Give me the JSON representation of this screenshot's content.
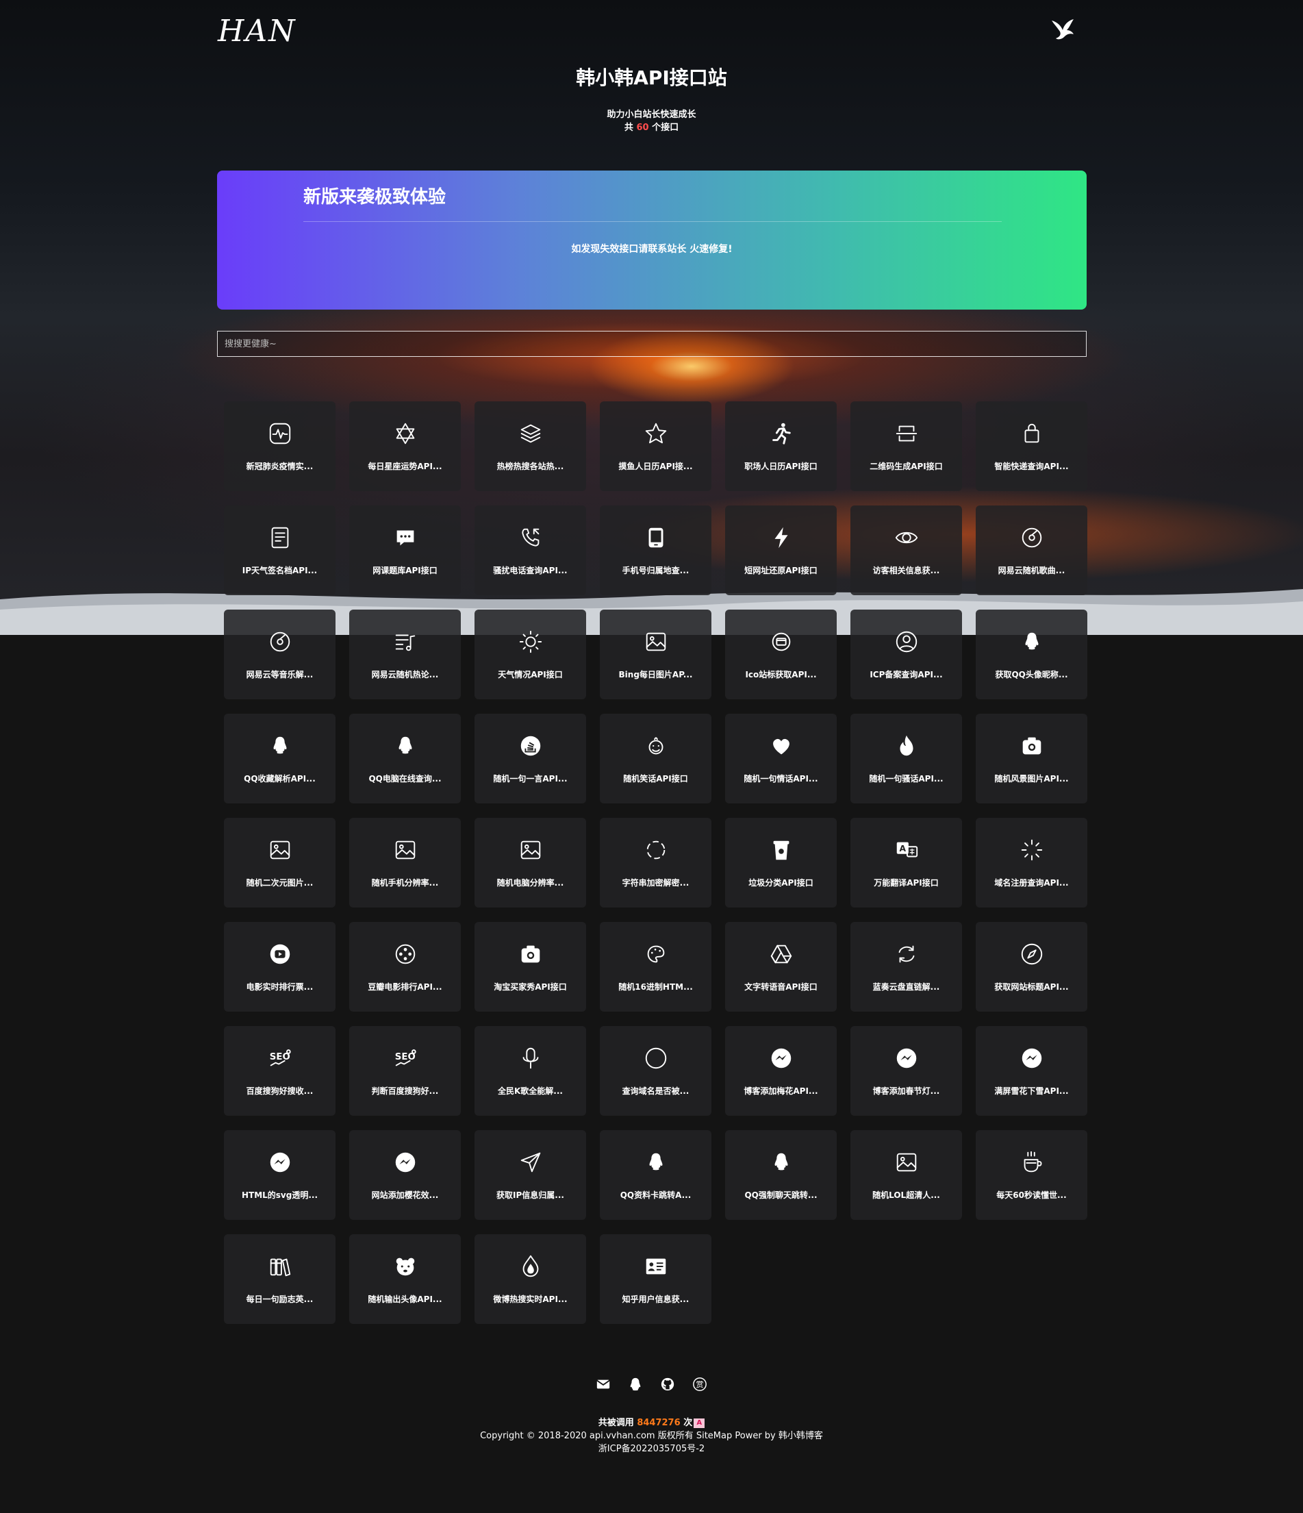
{
  "header": {
    "logo_text": "HAN",
    "site_title": "韩小韩API接口站",
    "subtitle": "助力小白站长快速成长",
    "count_prefix": "共",
    "count_value": "60",
    "count_suffix": "个接口"
  },
  "banner": {
    "title": "新版来袭极致体验",
    "text": "如发现失效接口请联系站长 火速修复!"
  },
  "search": {
    "placeholder": "搜搜更健康~"
  },
  "cards": [
    {
      "label": "新冠肺炎疫情实...",
      "icon": "pulse-icon"
    },
    {
      "label": "每日星座运势API...",
      "icon": "star-of-david-icon"
    },
    {
      "label": "热榜热搜各站热...",
      "icon": "layers-icon"
    },
    {
      "label": "摸鱼人日历API接...",
      "icon": "star-icon"
    },
    {
      "label": "职场人日历API接口",
      "icon": "running-person-icon"
    },
    {
      "label": "二维码生成API接口",
      "icon": "qrcode-icon"
    },
    {
      "label": "智能快递查询API...",
      "icon": "shopping-bag-icon"
    },
    {
      "label": "IP天气签名档API...",
      "icon": "document-icon"
    },
    {
      "label": "网课题库API接口",
      "icon": "chat-bubble-icon"
    },
    {
      "label": "骚扰电话查询API...",
      "icon": "phone-icon"
    },
    {
      "label": "手机号归属地查...",
      "icon": "tablet-icon"
    },
    {
      "label": "短网址还原API接口",
      "icon": "lightning-icon"
    },
    {
      "label": "访客相关信息获...",
      "icon": "eye-icon"
    },
    {
      "label": "网易云随机歌曲...",
      "icon": "disc-icon"
    },
    {
      "label": "网易云等音乐解...",
      "icon": "disc-icon"
    },
    {
      "label": "网易云随机热论...",
      "icon": "music-list-icon"
    },
    {
      "label": "天气情况API接口",
      "icon": "sun-icon"
    },
    {
      "label": "Bing每日图片AP...",
      "icon": "image-icon"
    },
    {
      "label": "Ico站标获取API...",
      "icon": "browser-icon"
    },
    {
      "label": "ICP备案查询API...",
      "icon": "user-circle-icon"
    },
    {
      "label": "获取QQ头像昵称...",
      "icon": "qq-icon"
    },
    {
      "label": "QQ收藏解析API...",
      "icon": "qq-icon"
    },
    {
      "label": "QQ电脑在线查询...",
      "icon": "qq-icon"
    },
    {
      "label": "随机一句一言API...",
      "icon": "stack-overflow-icon"
    },
    {
      "label": "随机笑话API接口",
      "icon": "laugh-icon"
    },
    {
      "label": "随机一句情话API...",
      "icon": "heart-icon"
    },
    {
      "label": "随机一句骚话API...",
      "icon": "fire-icon"
    },
    {
      "label": "随机风景图片API...",
      "icon": "camera-icon"
    },
    {
      "label": "随机二次元图片...",
      "icon": "image-icon"
    },
    {
      "label": "随机手机分辨率...",
      "icon": "image-icon"
    },
    {
      "label": "随机电脑分辨率...",
      "icon": "image-icon"
    },
    {
      "label": "字符串加密解密...",
      "icon": "loading-circle-icon"
    },
    {
      "label": "垃圾分类API接口",
      "icon": "trash-cup-icon"
    },
    {
      "label": "万能翻译API接口",
      "icon": "translate-icon"
    },
    {
      "label": "域名注册查询API...",
      "icon": "spinner-icon"
    },
    {
      "label": "电影实时排行票...",
      "icon": "play-icon"
    },
    {
      "label": "豆瓣电影排行API...",
      "icon": "film-reel-icon"
    },
    {
      "label": "淘宝买家秀API接口",
      "icon": "camera-icon"
    },
    {
      "label": "随机16进制HTM...",
      "icon": "palette-icon"
    },
    {
      "label": "文字转语音API接口",
      "icon": "drive-icon"
    },
    {
      "label": "蓝奏云盘直链解...",
      "icon": "refresh-icon"
    },
    {
      "label": "获取网站标题API...",
      "icon": "compass-icon"
    },
    {
      "label": "百度搜狗好搜收...",
      "icon": "seo-icon"
    },
    {
      "label": "判断百度搜狗好...",
      "icon": "seo-icon"
    },
    {
      "label": "全民K歌全能解...",
      "icon": "microphone-icon"
    },
    {
      "label": "查询域名是否被...",
      "icon": "circle-icon"
    },
    {
      "label": "博客添加梅花API...",
      "icon": "messenger-icon"
    },
    {
      "label": "博客添加春节灯...",
      "icon": "messenger-icon"
    },
    {
      "label": "满屏雪花下雪API...",
      "icon": "messenger-icon"
    },
    {
      "label": "HTML的svg透明...",
      "icon": "messenger-icon"
    },
    {
      "label": "网站添加樱花效...",
      "icon": "messenger-icon"
    },
    {
      "label": "获取IP信息归属...",
      "icon": "send-icon"
    },
    {
      "label": "QQ资料卡跳转A...",
      "icon": "qq-icon"
    },
    {
      "label": "QQ强制聊天跳转...",
      "icon": "qq-icon"
    },
    {
      "label": "随机LOL超清人...",
      "icon": "image-icon"
    },
    {
      "label": "每天60秒读懂世...",
      "icon": "coffee-cup-icon"
    },
    {
      "label": "每日一句励志英...",
      "icon": "books-icon"
    },
    {
      "label": "随机输出头像API...",
      "icon": "bear-icon"
    },
    {
      "label": "微博热搜实时API...",
      "icon": "flame-drop-icon"
    },
    {
      "label": "知乎用户信息获...",
      "icon": "id-card-icon"
    }
  ],
  "footer": {
    "icons": [
      "mail-icon",
      "qq-icon",
      "github-icon",
      "reward-icon"
    ],
    "reward_glyph": "赏",
    "calls_prefix": "共被调用",
    "calls_value": "8447276",
    "calls_suffix": "次",
    "calls_badge": "A",
    "copyright": "Copyright © 2018-2020 api.vvhan.com 版权所有 SiteMap Power by 韩小韩博客",
    "icp": "浙ICP备2022035705号-2"
  },
  "colors": {
    "banner_start": "#6a3dfa",
    "banner_end": "#2fe684",
    "count_highlight": "#ff4d4d",
    "calls_highlight": "#ff7a1a",
    "card_bg": "#222224",
    "page_bg": "#141414"
  }
}
